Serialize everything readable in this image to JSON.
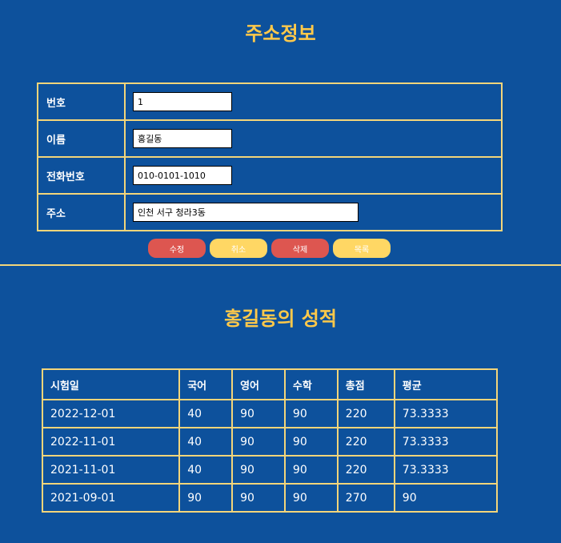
{
  "address": {
    "title": "주소정보",
    "rows": [
      {
        "label": "번호",
        "value": "1"
      },
      {
        "label": "이름",
        "value": "홍길동"
      },
      {
        "label": "전화번호",
        "value": "010-0101-1010"
      },
      {
        "label": "주소",
        "value": "인천 서구 청라3동"
      }
    ],
    "buttons": {
      "edit": "수정",
      "cancel": "취소",
      "delete": "삭제",
      "list": "목록"
    }
  },
  "grades": {
    "title": "홍길동의 성적",
    "headers": [
      "시험일",
      "국어",
      "영어",
      "수학",
      "총점",
      "평균"
    ],
    "rows": [
      [
        "2022-12-01",
        "40",
        "90",
        "90",
        "220",
        "73.3333"
      ],
      [
        "2022-11-01",
        "40",
        "90",
        "90",
        "220",
        "73.3333"
      ],
      [
        "2021-11-01",
        "40",
        "90",
        "90",
        "220",
        "73.3333"
      ],
      [
        "2021-09-01",
        "90",
        "90",
        "90",
        "270",
        "90"
      ]
    ]
  },
  "colors": {
    "background": "#0d519c",
    "accent": "#ffc94a",
    "border": "#f3d57a",
    "button_red": "#dd5650",
    "button_yellow": "#ffd764"
  }
}
